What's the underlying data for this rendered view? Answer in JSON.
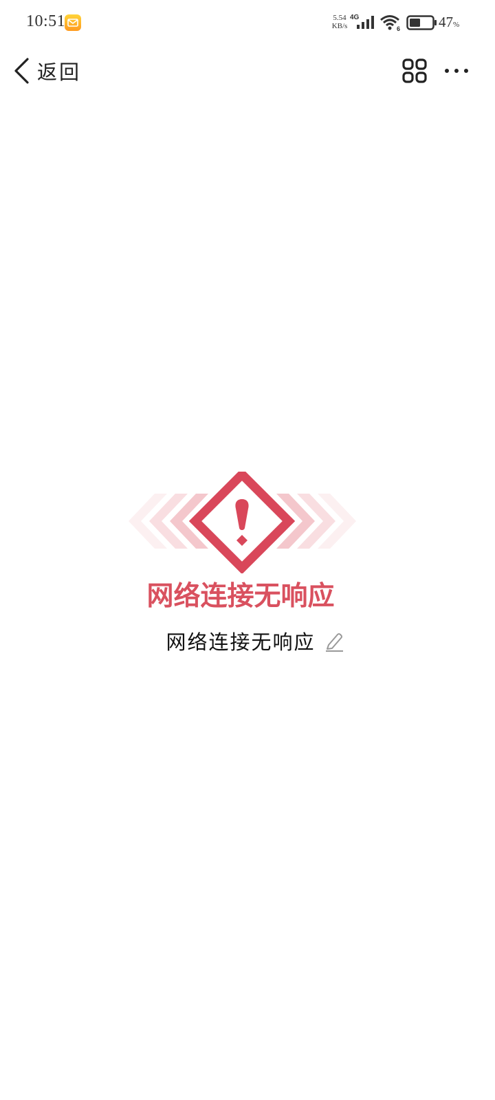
{
  "status_bar": {
    "time": "10:51",
    "net_speed_value": "5.54",
    "net_speed_unit": "KB/s",
    "network_type": "4G",
    "wifi_badge": "6",
    "battery_percent": "47",
    "battery_percent_sign": "%",
    "battery_level": 0.47,
    "notification_icon": "mail-icon"
  },
  "nav": {
    "back_label": "返回",
    "back_icon": "chevron-left-icon",
    "apps_icon": "four-squares-icon",
    "more_icon": "more-dots-icon"
  },
  "error": {
    "banner_text": "网络连接无响应",
    "title": "网络连接无响应",
    "edit_icon": "pencil-icon",
    "accent_color": "#d9515f"
  }
}
